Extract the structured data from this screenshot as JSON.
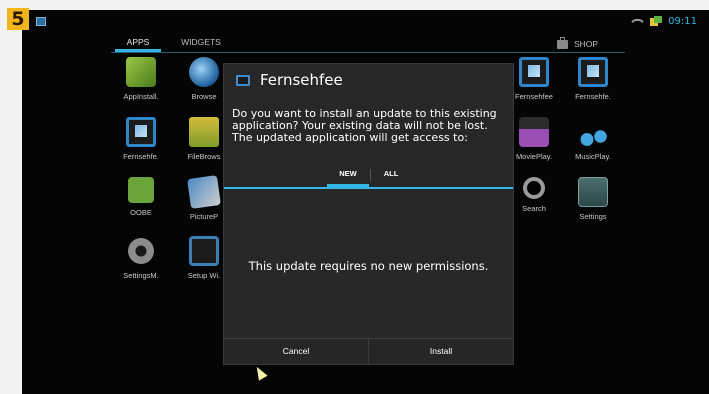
{
  "step_badge": "5",
  "status_bar": {
    "clock": "09:11"
  },
  "launcher": {
    "tabs": {
      "apps": "APPS",
      "widgets": "WIDGETS",
      "shop": "SHOP"
    },
    "apps": [
      {
        "label": "AppInstall.",
        "icon": "app-installer-icon"
      },
      {
        "label": "Browse",
        "icon": "browser-globe-icon"
      },
      {
        "label": "Fernsehfee",
        "icon": "tv-icon"
      },
      {
        "label": "Fernsehfe.",
        "icon": "tv-icon"
      },
      {
        "label": "Fernsehfe.",
        "icon": "tv-icon"
      },
      {
        "label": "FileBrows",
        "icon": "folder-icon"
      },
      {
        "label": "MoviePlay.",
        "icon": "movie-icon"
      },
      {
        "label": "MusicPlay.",
        "icon": "music-note-icon"
      },
      {
        "label": "OOBE",
        "icon": "android-icon"
      },
      {
        "label": "PictureP",
        "icon": "picture-icon"
      },
      {
        "label": "Search",
        "icon": "search-icon"
      },
      {
        "label": "Settings",
        "icon": "settings-sliders-icon"
      },
      {
        "label": "SettingsM.",
        "icon": "gear-icon"
      },
      {
        "label": "Setup Wi.",
        "icon": "tv-icon"
      }
    ]
  },
  "dialog": {
    "title": "Fernsehfee",
    "message": "Do you want to install an update to this existing application? Your existing data will not be lost. The updated application will get access to:",
    "tabs": {
      "new": "NEW",
      "all": "ALL"
    },
    "body": "This update requires no new permissions.",
    "cancel": "Cancel",
    "install": "Install"
  },
  "colors": {
    "accent": "#33b5e5",
    "badge": "#f2b51c",
    "dialog_bg": "#272727"
  }
}
